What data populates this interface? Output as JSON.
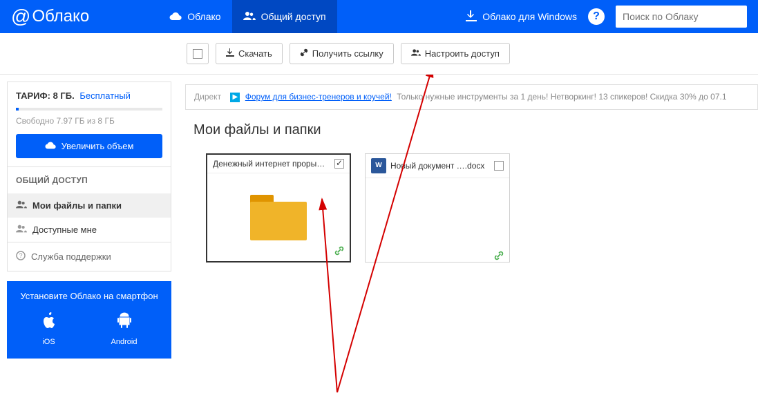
{
  "header": {
    "logo": "Облако",
    "nav": {
      "cloud": "Облако",
      "shared": "Общий доступ"
    },
    "windows_link": "Облако для Windows",
    "search_placeholder": "Поиск по Облаку"
  },
  "toolbar": {
    "download": "Скачать",
    "get_link": "Получить ссылку",
    "configure_access": "Настроить доступ"
  },
  "sidebar": {
    "tariff_label": "ТАРИФ:",
    "tariff_size": "8 ГБ.",
    "tariff_plan": "Бесплатный",
    "free_text": "Свободно 7.97 ГБ из 8 ГБ",
    "upgrade": "Увеличить объем",
    "shared_title": "ОБЩИЙ ДОСТУП",
    "my_files": "Мои файлы и папки",
    "available": "Доступные мне",
    "support": "Служба поддержки",
    "promo_title": "Установите Облако на смартфон",
    "ios": "iOS",
    "android": "Android"
  },
  "ad": {
    "label": "Директ",
    "link": "Форум для бизнес-тренеров и коучей!",
    "text": "Только нужные инструменты за 1 день! Нетворкинг! 13 спикеров! Скидка 30% до 07.1"
  },
  "page": {
    "title": "Мои файлы и папки"
  },
  "files": [
    {
      "name": "Денежный интернет проры…",
      "type": "folder",
      "checked": true
    },
    {
      "name": "Новый документ ….docx",
      "type": "docx",
      "checked": false
    }
  ]
}
